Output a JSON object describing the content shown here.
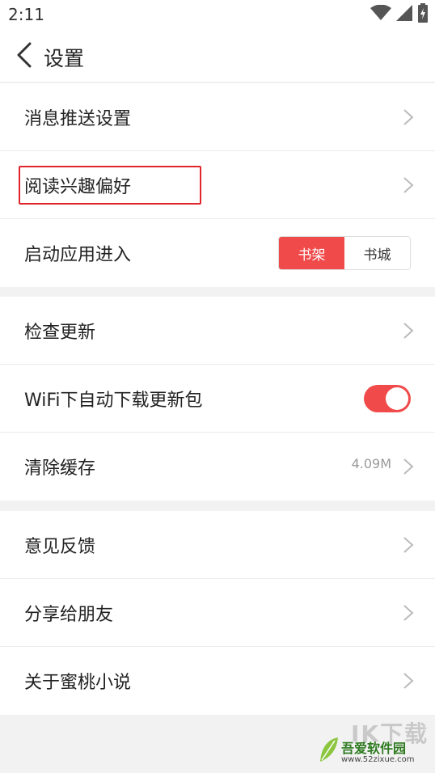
{
  "status_bar": {
    "time": "2:11"
  },
  "header": {
    "title": "设置"
  },
  "groups": [
    {
      "items": [
        {
          "label": "消息推送设置"
        },
        {
          "label": "阅读兴趣偏好"
        },
        {
          "label": "启动应用进入",
          "segments": [
            "书架",
            "书城"
          ],
          "selected": "书架"
        }
      ]
    },
    {
      "items": [
        {
          "label": "检查更新"
        },
        {
          "label": "WiFi下自动下载更新包",
          "toggle_on": true
        },
        {
          "label": "清除缓存",
          "value": "4.09M"
        }
      ]
    },
    {
      "items": [
        {
          "label": "意见反馈"
        },
        {
          "label": "分享给朋友"
        },
        {
          "label": "关于蜜桃小说"
        }
      ]
    }
  ],
  "watermark": {
    "brand": "吾爱软件园",
    "url": "www.52zixue.com",
    "big_text": "IK下载"
  },
  "colors": {
    "accent": "#f04a4a",
    "highlight_border": "#e0262c",
    "background": "#f2f2f2"
  }
}
